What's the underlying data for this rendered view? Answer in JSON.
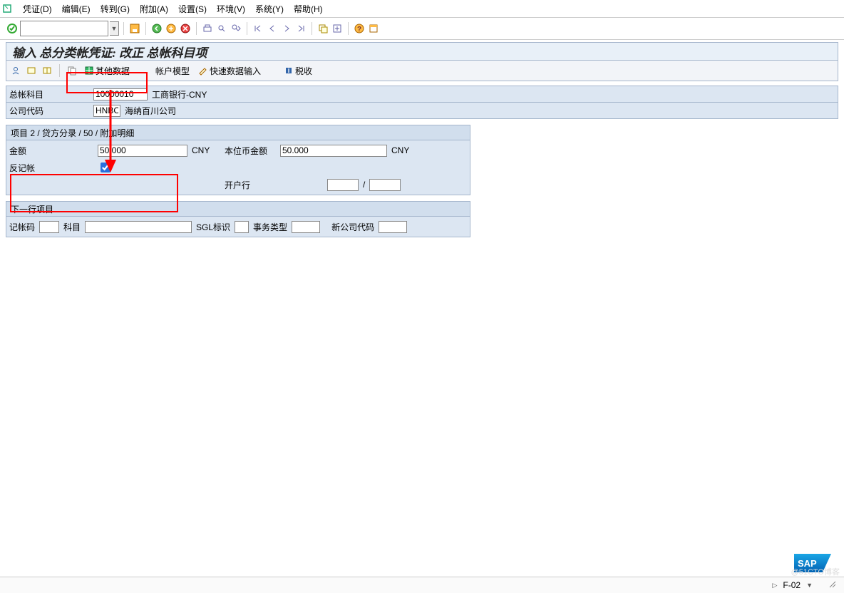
{
  "menu": {
    "voucher": "凭证(D)",
    "edit": "编辑(E)",
    "goto": "转到(G)",
    "attach": "附加(A)",
    "settings": "设置(S)",
    "env": "环境(V)",
    "system": "系统(Y)",
    "help": "帮助(H)"
  },
  "title": "输入 总分类帐凭证: 改正 总帐科目项",
  "apptb": {
    "other_data": "其他数据",
    "acct_model": "帐户模型",
    "fast_entry": "快速数据输入",
    "tax": "税收"
  },
  "hdr": {
    "gl_account_lbl": "总帐科目",
    "gl_account": "10000010",
    "gl_desc": "工商银行-CNY",
    "company_lbl": "公司代码",
    "company": "HNBC",
    "company_desc": "海纳百川公司"
  },
  "g1": {
    "title": "项目 2 / 贷方分录 / 50 / 附加明细",
    "amount_lbl": "金额",
    "amount": "50.000",
    "curr": "CNY",
    "local_amount_lbl": "本位币金额",
    "local_amount": "50.000",
    "local_curr": "CNY",
    "reverse_lbl": "反记帐",
    "bank_lbl": "开户行",
    "slash": "/"
  },
  "g2": {
    "title": "下一行项目",
    "post_key_lbl": "记帐码",
    "account_lbl": "科目",
    "sgl_lbl": "SGL标识",
    "trans_lbl": "事务类型",
    "newco_lbl": "新公司代码"
  },
  "status": {
    "tcode": "F-02"
  },
  "watermark": "@51CTO博客"
}
